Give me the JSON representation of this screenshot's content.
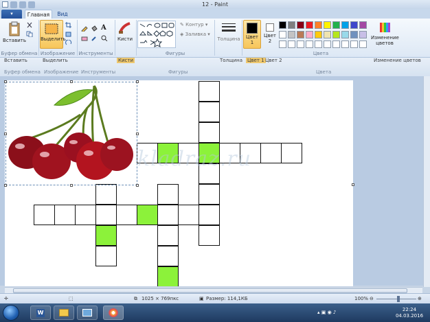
{
  "window": {
    "title": "12 - Paint"
  },
  "tabs": {
    "file": "▾",
    "home": "Главная",
    "view": "Вид"
  },
  "ribbon": {
    "clipboard": {
      "paste": "Вставить",
      "group": "Буфер обмена"
    },
    "image": {
      "select": "Выделить",
      "group": "Изображение"
    },
    "tools": {
      "group": "Инструменты"
    },
    "brushes": {
      "label": "Кисти"
    },
    "shapes": {
      "outline": "Контур",
      "fill": "Заливка",
      "group": "Фигуры"
    },
    "size": {
      "label": "Толщина"
    },
    "colors": {
      "color1": "Цвет 1",
      "color2": "Цвет 2",
      "group": "Цвета",
      "edit": "Изменение цветов",
      "palette_row1": [
        "#000000",
        "#7f7f7f",
        "#880015",
        "#ed1c24",
        "#ff7f27",
        "#fff200",
        "#22b14c",
        "#00a2e8",
        "#3f48cc",
        "#a349a4"
      ],
      "palette_row2": [
        "#ffffff",
        "#c3c3c3",
        "#b97a57",
        "#ffaec9",
        "#ffc90e",
        "#efe4b0",
        "#b5e61d",
        "#99d9ea",
        "#7092be",
        "#c8bfe7"
      ]
    }
  },
  "ghost_ribbon": {
    "paste": "Вставить",
    "select": "Выделить",
    "brushes": "Кисти",
    "size": "Толщина",
    "color1": "Цвет 1",
    "color2": "Цвет 2",
    "edit": "Изменение цветов",
    "clipboard": "Буфер обмена",
    "image": "Изображение",
    "tools": "Инструменты",
    "shapes": "Фигуры",
    "colors": "Цвета"
  },
  "canvas": {
    "watermark": "kladraz.ru"
  },
  "status": {
    "dimensions": "1025 × 769пкс",
    "size": "Размер: 114,1КБ",
    "zoom": "100%"
  },
  "taskbar": {
    "time": "22:24",
    "date": "04.03.2016"
  },
  "colors": {
    "cell_green": "#8cf23a",
    "accent": "#23509a"
  }
}
